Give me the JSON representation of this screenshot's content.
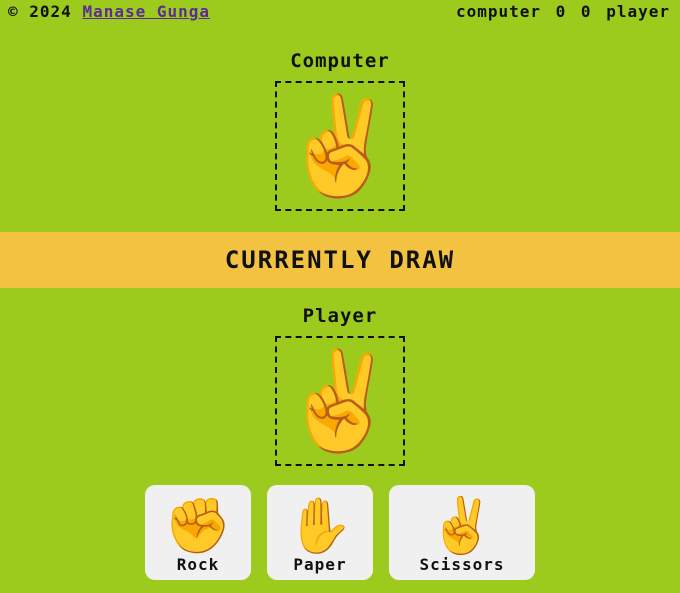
{
  "footer": {
    "copyright_prefix": "© 2024",
    "author_link": "Manase Gunga"
  },
  "score": {
    "computer_label": "computer",
    "computer_score": "0",
    "player_score": "0",
    "player_label": "player"
  },
  "computer": {
    "label": "Computer",
    "choice_emoji": "✌️"
  },
  "result": {
    "text": "CURRENTLY DRAW"
  },
  "player": {
    "label": "Player",
    "choice_emoji": "✌️"
  },
  "moves": [
    {
      "emoji": "✊",
      "label": "Rock"
    },
    {
      "emoji": "✋",
      "label": "Paper"
    },
    {
      "emoji": "✌️",
      "label": "Scissors"
    }
  ],
  "colors": {
    "background": "#9ccb1e",
    "banner": "#f4c241",
    "button": "#f0f0f0",
    "link": "#5b2b96"
  }
}
